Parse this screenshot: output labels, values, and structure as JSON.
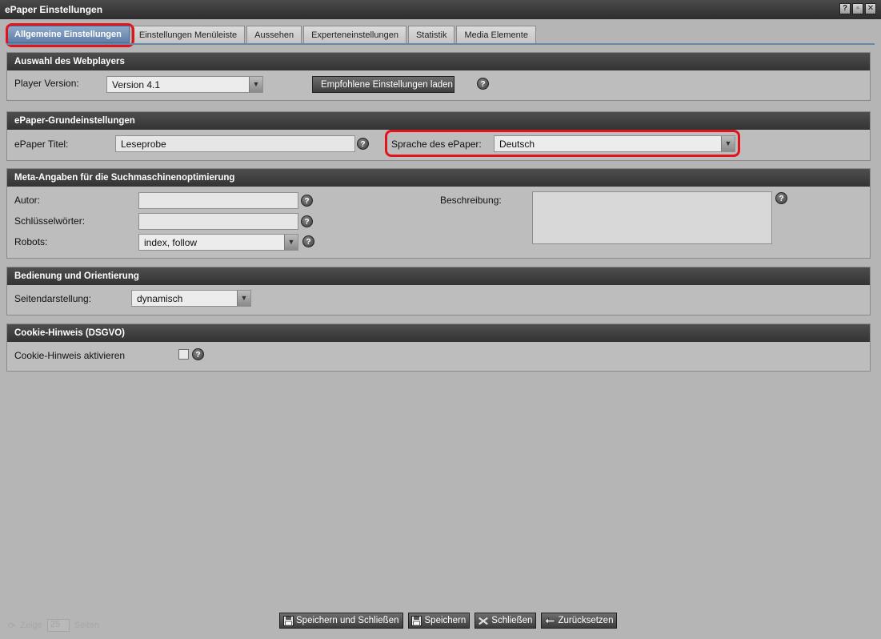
{
  "window": {
    "title": "ePaper Einstellungen",
    "controls": [
      "?",
      "▫",
      "✕"
    ]
  },
  "tabs": [
    {
      "label": "Allgemeine Einstellungen",
      "active": true
    },
    {
      "label": "Einstellungen Menüleiste",
      "active": false
    },
    {
      "label": "Aussehen",
      "active": false
    },
    {
      "label": "Experteneinstellungen",
      "active": false
    },
    {
      "label": "Statistik",
      "active": false
    },
    {
      "label": "Media Elemente",
      "active": false
    }
  ],
  "webplayer": {
    "header": "Auswahl des Webplayers",
    "player_version_label": "Player Version:",
    "player_version_value": "Version 4.1",
    "load_button": "Empfohlene Einstellungen laden"
  },
  "basics": {
    "header": "ePaper-Grundeinstellungen",
    "title_label": "ePaper Titel:",
    "title_value": "Leseprobe",
    "language_label": "Sprache des ePaper:",
    "language_value": "Deutsch"
  },
  "seo": {
    "header": "Meta-Angaben für die Suchmaschinenoptimierung",
    "author_label": "Autor:",
    "author_value": "",
    "keywords_label": "Schlüsselwörter:",
    "keywords_value": "",
    "robots_label": "Robots:",
    "robots_value": "index, follow",
    "description_label": "Beschreibung:"
  },
  "navigation": {
    "header": "Bedienung und Orientierung",
    "page_display_label": "Seitendarstellung:",
    "page_display_value": "dynamisch"
  },
  "cookie": {
    "header": "Cookie-Hinweis (DSGVO)",
    "activate_label": "Cookie-Hinweis aktivieren",
    "checked": false
  },
  "footer": {
    "save_close": "Speichern und Schließen",
    "save": "Speichern",
    "close": "Schließen",
    "reset": "Zurücksetzen"
  },
  "pager_bg": {
    "show_label": "Zeige",
    "per_page": "25",
    "pages_label": "Seiten"
  },
  "colors": {
    "highlight": "#e0141c",
    "active_tab": "#6f8db3",
    "panel_header": "#3d3d3d"
  }
}
